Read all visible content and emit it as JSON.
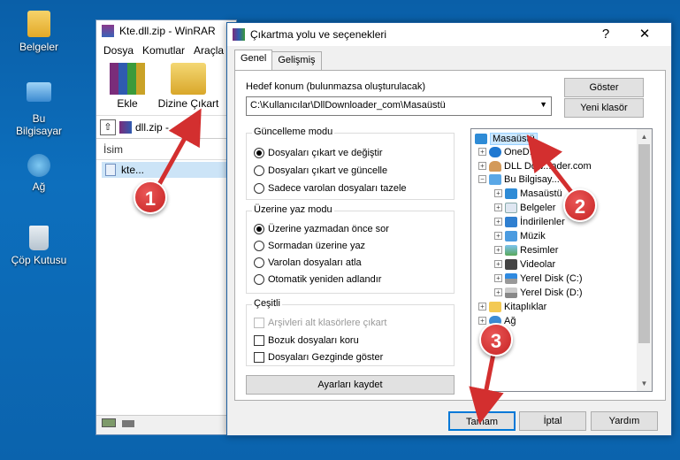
{
  "desktop": {
    "icons": [
      {
        "label": "Belgeler",
        "icon": "documents-folder-icon"
      },
      {
        "label": "Bu Bilgisayar",
        "icon": "computer-icon"
      },
      {
        "label": "Ağ",
        "icon": "network-icon"
      },
      {
        "label": "Çöp Kutusu",
        "icon": "recycle-bin-icon"
      }
    ]
  },
  "winrar": {
    "title": "Kte.dll.zip - WinRAR",
    "menu": [
      "Dosya",
      "Komutlar",
      "Araçla"
    ],
    "toolbar": {
      "add": "Ekle",
      "extract": "Dizine Çıkart"
    },
    "path": "dll.zip - ...",
    "column": "İsim",
    "row": "kte..."
  },
  "dialog": {
    "title": "Çıkartma yolu ve seçenekleri",
    "help_btn": "?",
    "close_btn": "✕",
    "tabs": [
      "Genel",
      "Gelişmiş"
    ],
    "destination_label": "Hedef konum (bulunmazsa oluşturulacak)",
    "destination_value": "C:\\Kullanıcılar\\DllDownloader_com\\Masaüstü",
    "show_btn": "Göster",
    "new_folder_btn": "Yeni klasör",
    "update_mode": {
      "title": "Güncelleme modu",
      "options": [
        "Dosyaları çıkart ve değiştir",
        "Dosyaları çıkart ve güncelle",
        "Sadece varolan dosyaları tazele"
      ],
      "selected": 0
    },
    "overwrite_mode": {
      "title": "Üzerine yaz modu",
      "options": [
        "Üzerine yazmadan önce sor",
        "Sormadan üzerine yaz",
        "Varolan dosyaları atla",
        "Otomatik yeniden adlandır"
      ],
      "selected": 0
    },
    "misc": {
      "title": "Çeşitli",
      "options": [
        "Arşivleri alt klasörlere çıkart",
        "Bozuk dosyaları koru",
        "Dosyaları Gezginde göster"
      ]
    },
    "save_settings_btn": "Ayarları kaydet",
    "tree": {
      "root": "Masaüstü",
      "onedrive": "OneD...",
      "dlldownloader": "DLL Dow...ader.com",
      "thispc": "Bu Bilgisay...",
      "children": [
        "Masaüstü",
        "Belgeler",
        "İndirilenler",
        "Müzik",
        "Resimler",
        "Videolar",
        "Yerel Disk (C:)",
        "Yerel Disk (D:)"
      ],
      "libraries": "Kitaplıklar",
      "network": "Ağ"
    },
    "ok_btn": "Tamam",
    "cancel_btn": "İptal",
    "help2_btn": "Yardım"
  },
  "callouts": [
    "1",
    "2",
    "3"
  ],
  "colors": {
    "callout": "#d32f2f",
    "selection": "#cce8ff",
    "desktop": "#0b63ad"
  }
}
